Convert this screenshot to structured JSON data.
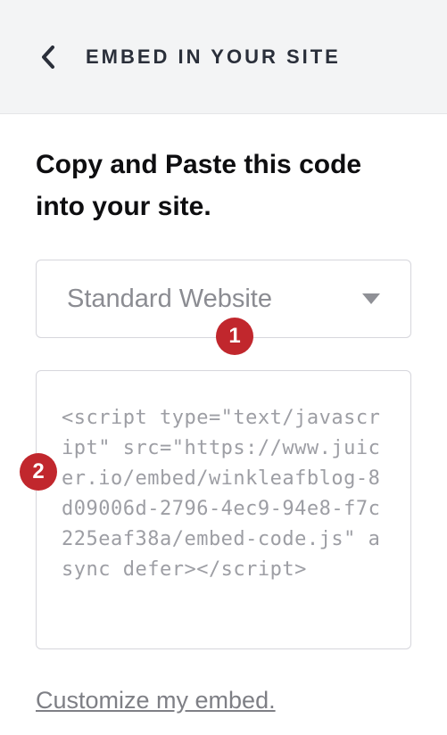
{
  "header": {
    "title": "EMBED IN YOUR SITE"
  },
  "main": {
    "heading": "Copy and Paste this code into your site.",
    "select": {
      "selected": "Standard Website"
    },
    "code": "<script type=\"text/javascript\" src=\"https://www.juicer.io/embed/winkleafblog-8d09006d-2796-4ec9-94e8-f7c225eaf38a/embed-code.js\" async defer></script>",
    "customize_link": "Customize my embed."
  },
  "annotations": {
    "badge1": "1",
    "badge2": "2"
  }
}
